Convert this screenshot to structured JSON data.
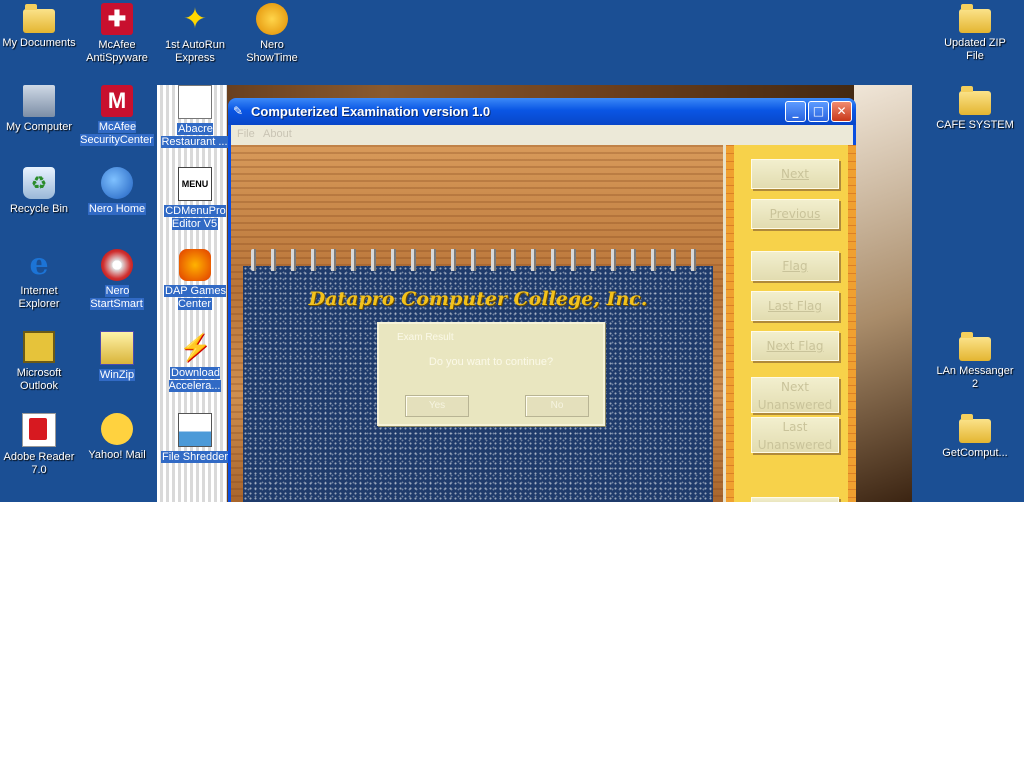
{
  "desktop": {
    "icons": [
      {
        "label": "My Documents",
        "icon": "my-documents-folder-icon"
      },
      {
        "label": "McAfee AntiSpyware",
        "icon": "mcafee-antispyware-icon"
      },
      {
        "label": "1st AutoRun Express",
        "icon": "autorun-express-icon"
      },
      {
        "label": "Nero ShowTime",
        "icon": "nero-showtime-icon"
      },
      {
        "label": "Updated ZIP File",
        "icon": "folder-icon"
      },
      {
        "label": "My Computer",
        "icon": "my-computer-icon"
      },
      {
        "label": "McAfee SecurityCenter",
        "icon": "mcafee-securitycenter-icon"
      },
      {
        "label": "Abacre Restaurant ...",
        "icon": "abacre-restaurant-icon"
      },
      {
        "label": "CAFE SYSTEM",
        "icon": "folder-icon"
      },
      {
        "label": "Recycle Bin",
        "icon": "recycle-bin-icon"
      },
      {
        "label": "Nero Home",
        "icon": "nero-home-icon"
      },
      {
        "label": "CDMenuPro Editor V5",
        "icon": "cdmenupro-icon"
      },
      {
        "label": "Internet Explorer",
        "icon": "internet-explorer-icon"
      },
      {
        "label": "Nero StartSmart",
        "icon": "nero-startsmart-icon"
      },
      {
        "label": "DAP Games Center",
        "icon": "dap-games-icon"
      },
      {
        "label": "Microsoft Outlook",
        "icon": "outlook-icon"
      },
      {
        "label": "WinZip",
        "icon": "winzip-icon"
      },
      {
        "label": "Download Accelera...",
        "icon": "download-accelerator-icon"
      },
      {
        "label": "LAn Messanger 2",
        "icon": "folder-icon"
      },
      {
        "label": "Adobe Reader 7.0",
        "icon": "adobe-reader-icon"
      },
      {
        "label": "Yahoo! Mail",
        "icon": "yahoo-mail-icon"
      },
      {
        "label": "File Shredder",
        "icon": "file-shredder-icon"
      },
      {
        "label": "GetComput...",
        "icon": "folder-icon"
      }
    ]
  },
  "window": {
    "title": "Computerized Examination version 1.0",
    "controls": {
      "minimize": "_",
      "maximize": "□",
      "close": "✕"
    },
    "menu": [
      "File",
      "About"
    ]
  },
  "exam": {
    "college_name": "Datapro Computer College, Inc.",
    "dialog": {
      "title_left": "Exam Result",
      "title_right": "",
      "message": "Do you want to continue?",
      "yes_label": "Yes",
      "no_label": "No"
    },
    "nav": {
      "next": "Next",
      "previous": "Previous",
      "flag": "Flag",
      "last_flag": "Last Flag",
      "next_flag": "Next Flag",
      "next_unanswered_1": "Next",
      "next_unanswered_2": "Unanswered",
      "last_unanswered_1": "Last",
      "last_unanswered_2": "Unanswered"
    }
  }
}
